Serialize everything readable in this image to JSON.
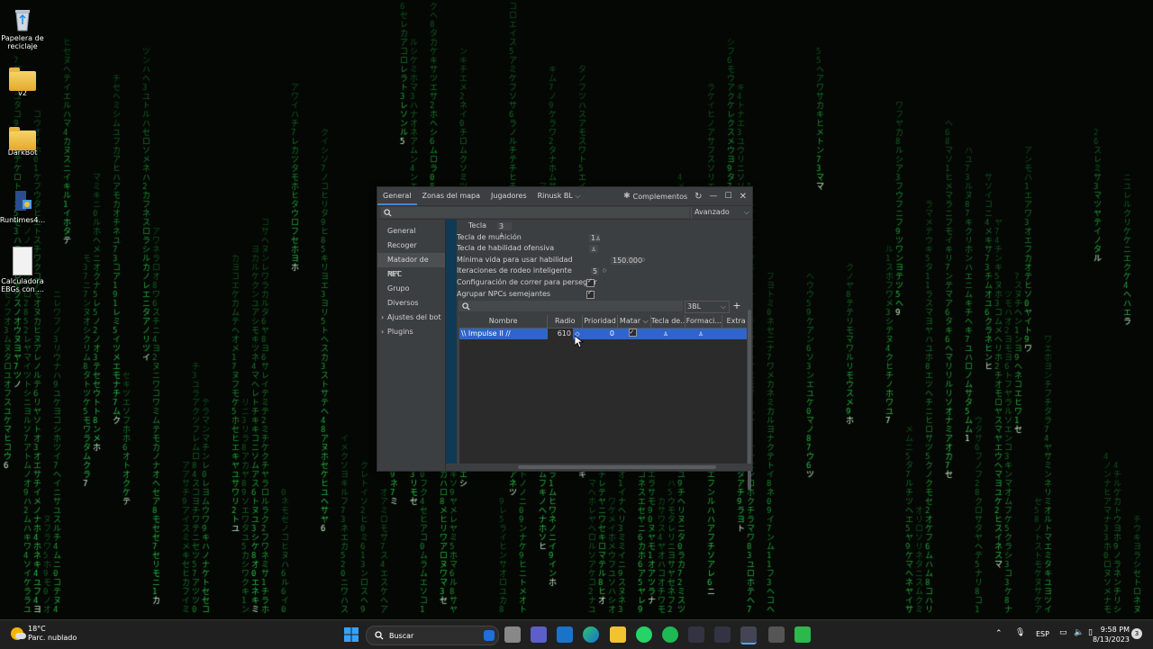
{
  "desktop": {
    "icons": [
      {
        "label": "Papelera de reciclaje"
      },
      {
        "label": "v2"
      },
      {
        "label": "DarkBot"
      },
      {
        "label": "Runtimes4..."
      },
      {
        "label": "Calculadora EBGs con ..."
      }
    ]
  },
  "window": {
    "tabs": [
      "General",
      "Zonas del mapa",
      "Jugadores",
      "Rinusk BL"
    ],
    "complementos_label": "Complementos",
    "search_placeholder": "",
    "mode_dropdown": "Avanzado",
    "sidebar": {
      "items": [
        "General",
        "Recoger",
        "Matador de NPC",
        "PET",
        "Grupo",
        "Diversos",
        "Ajustes del bot",
        "Plugins"
      ],
      "selected": "Matador de NPC"
    },
    "settings": {
      "tecla_label": "Tecla",
      "tecla_value": "3",
      "tecla_municion_label": "Tecla de munición",
      "tecla_municion_value": "1",
      "tecla_habilidad_label": "Tecla de habilidad ofensiva",
      "minima_vida_label": "Mínima vida para usar habilidad",
      "minima_vida_value": "150.000",
      "iteraciones_label": "Iteraciones de rodeo inteligente",
      "iteraciones_value": "5",
      "correr_label": "Configuración de correr para perseguir",
      "correr_checked": true,
      "agrupar_label": "Agrupar NPCs semejantes",
      "agrupar_checked": true
    },
    "table": {
      "filter_dropdown": "3BL",
      "columns": [
        "Nombre",
        "Radio",
        "Prioridad",
        "Matar",
        "Tecla de...",
        "Formaci...",
        "Extra"
      ],
      "rows": [
        {
          "nombre": "\\\\ Impulse II //",
          "radio": "610",
          "prioridad": "0",
          "matar": true
        }
      ]
    }
  },
  "taskbar": {
    "weather_temp": "18°C",
    "weather_desc": "Parc. nublado",
    "search_label": "Buscar",
    "lang": "ESP",
    "time": "9:58 PM",
    "date": "8/13/2023",
    "notification_count": "3"
  }
}
